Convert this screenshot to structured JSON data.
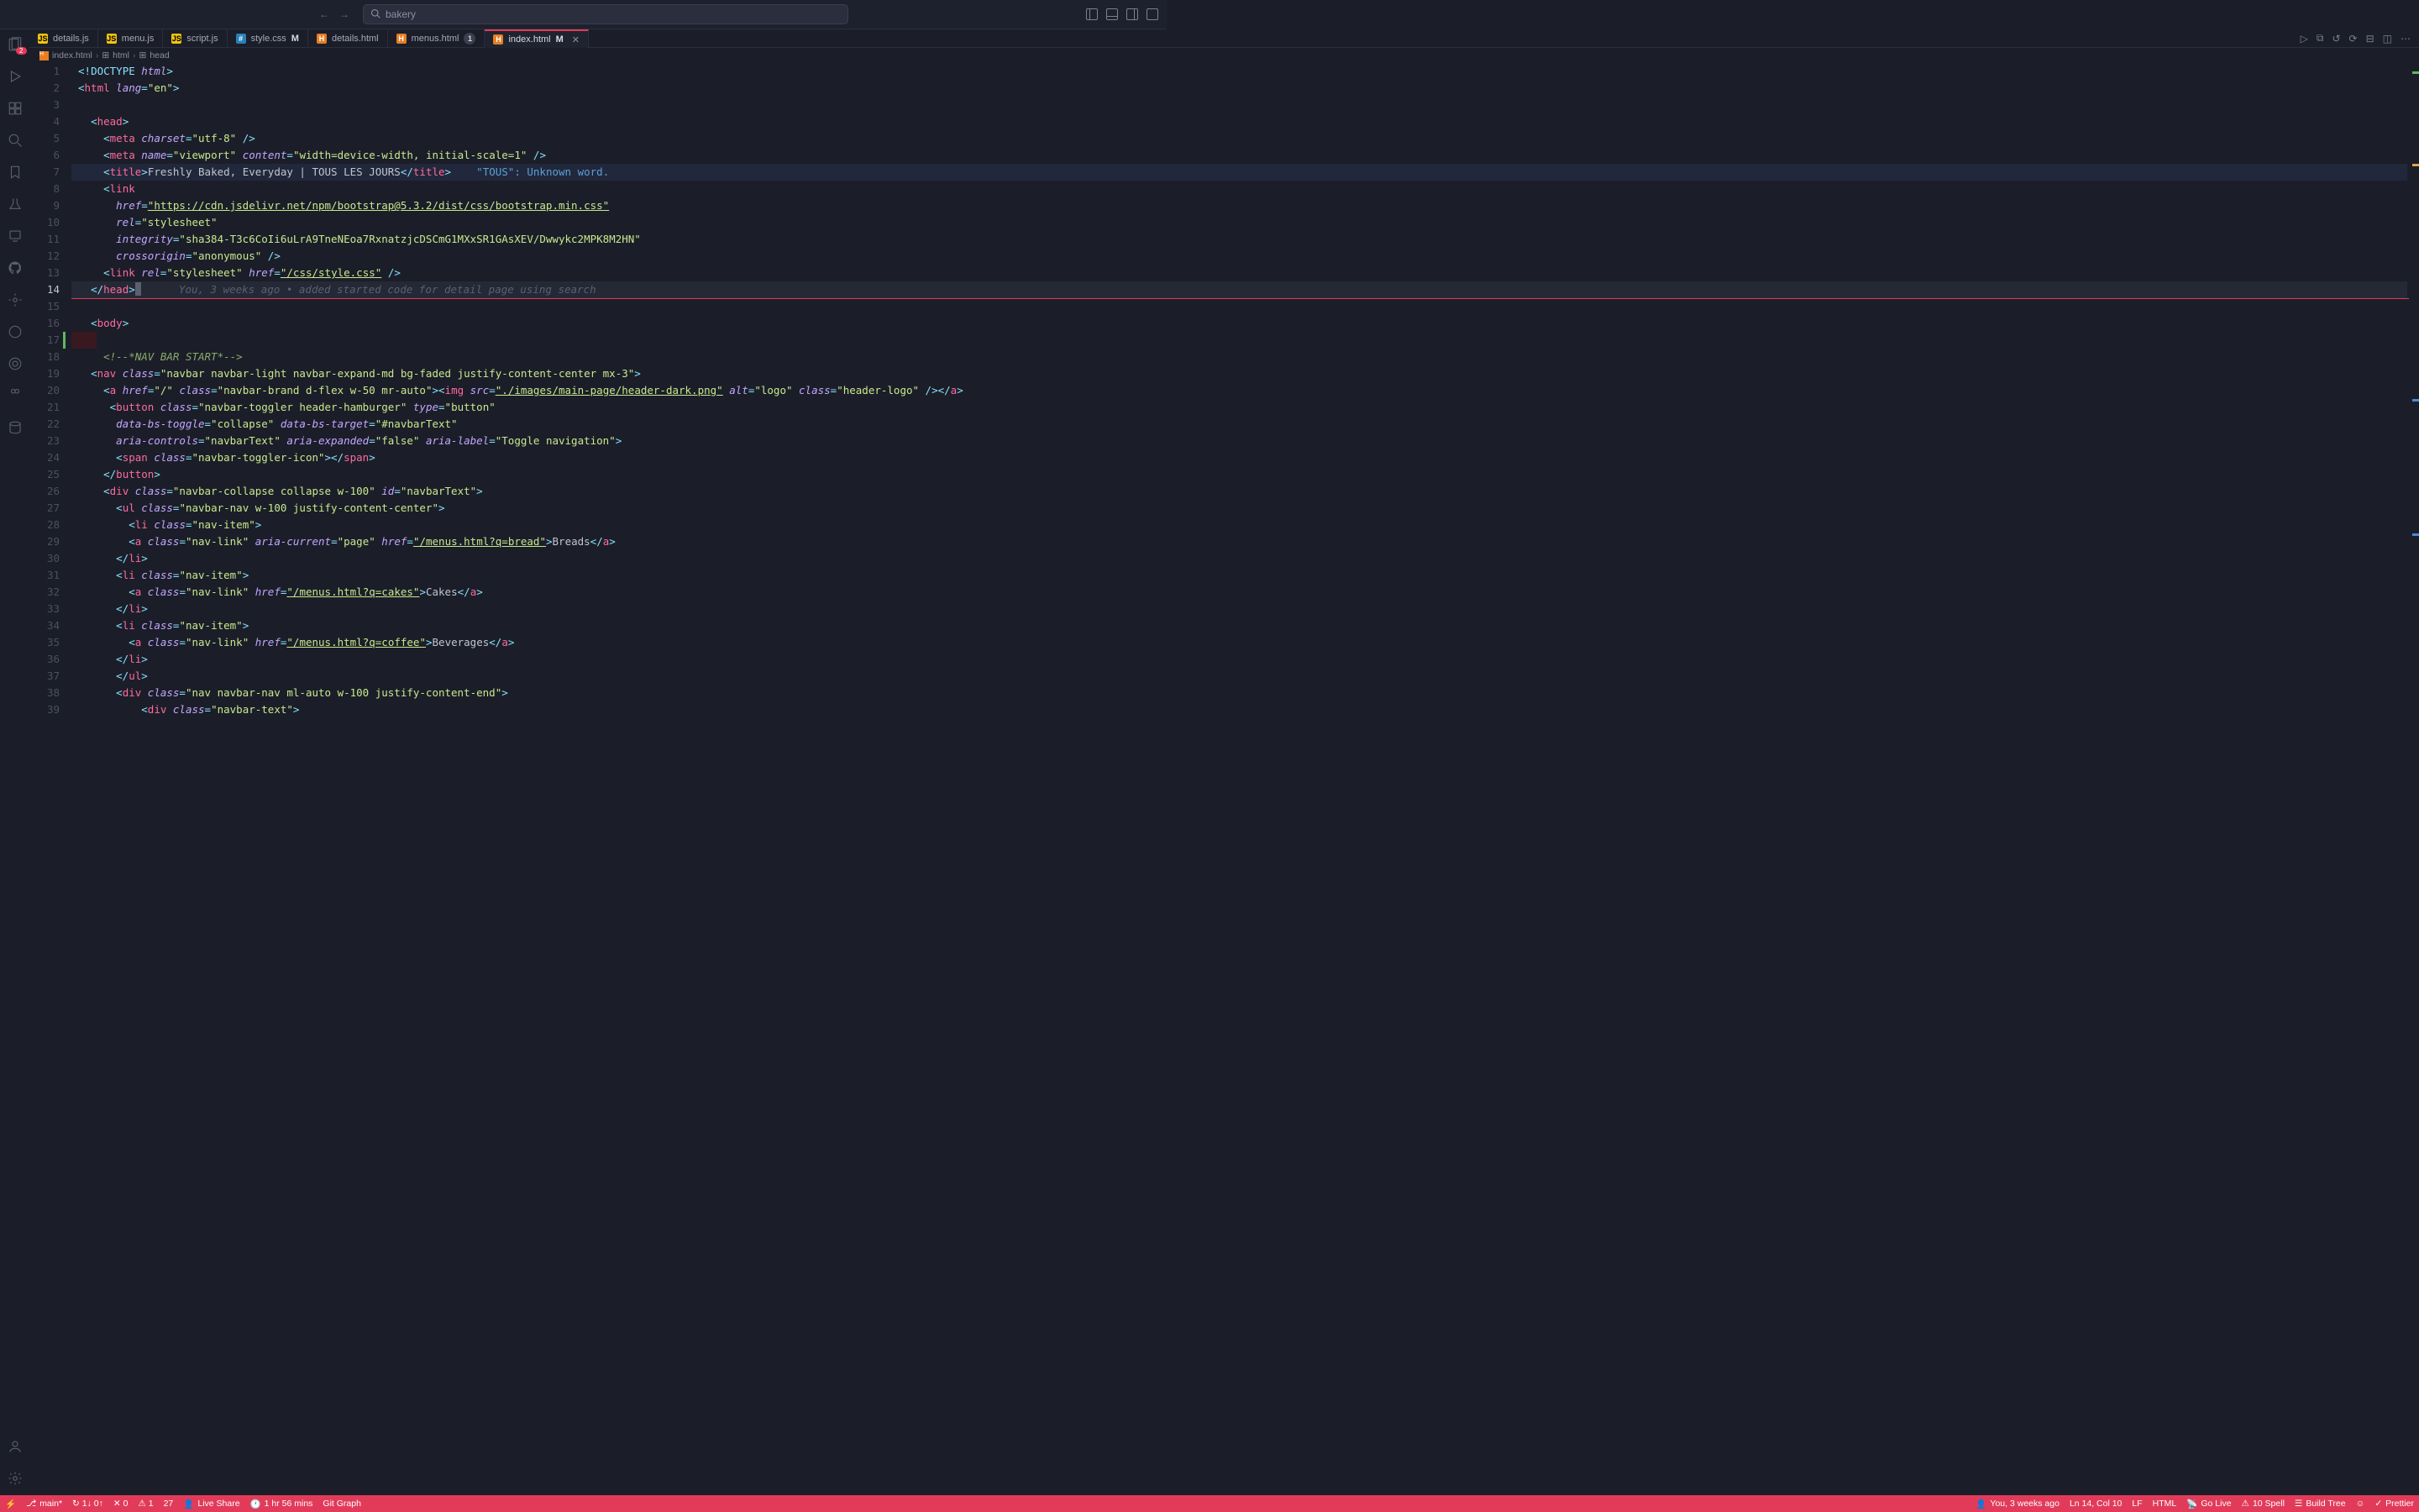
{
  "search": {
    "placeholder": "bakery"
  },
  "activity": {
    "explorer_badge": "2"
  },
  "tabs": [
    {
      "icon": "js",
      "label": "details.js",
      "status": ""
    },
    {
      "icon": "js",
      "label": "menu.js",
      "status": ""
    },
    {
      "icon": "js",
      "label": "script.js",
      "status": ""
    },
    {
      "icon": "css",
      "label": "style.css",
      "status": "M"
    },
    {
      "icon": "html",
      "label": "details.html",
      "status": ""
    },
    {
      "icon": "html",
      "label": "menus.html",
      "status": "1"
    },
    {
      "icon": "html",
      "label": "index.html",
      "status": "M",
      "active": true
    }
  ],
  "breadcrumb": [
    {
      "icon": "html",
      "label": "index.html"
    },
    {
      "icon": "tag",
      "label": "html"
    },
    {
      "icon": "tag",
      "label": "head"
    }
  ],
  "code": {
    "l1": {
      "a": "<!",
      "b": "DOCTYPE",
      "c": " html",
      "d": ">"
    },
    "l2": {
      "a": "<",
      "tag": "html",
      "attr": " lang",
      "eq": "=",
      "val": "\"en\"",
      "z": ">"
    },
    "l4": {
      "a": "<",
      "tag": "head",
      "z": ">"
    },
    "l5": {
      "a": "<",
      "tag": "meta",
      "attr": " charset",
      "val": "\"utf-8\"",
      "z": " />"
    },
    "l6": {
      "a": "<",
      "tag": "meta",
      "attr1": " name",
      "val1": "\"viewport\"",
      "attr2": " content",
      "val2": "\"width=device-width, initial-scale=1\"",
      "z": " />"
    },
    "l7": {
      "a": "<",
      "tag": "title",
      "b": ">",
      "txt": "Freshly Baked, Everyday | TOUS LES JOURS",
      "c": "</",
      "d": ">",
      "lint": "    \"TOUS\": Unknown word."
    },
    "l8": {
      "a": "<",
      "tag": "link"
    },
    "l9": {
      "attr": "href",
      "val": "\"https://cdn.jsdelivr.net/npm/bootstrap@5.3.2/dist/css/bootstrap.min.css\""
    },
    "l10": {
      "attr": "rel",
      "val": "\"stylesheet\""
    },
    "l11": {
      "attr": "integrity",
      "val": "\"sha384-T3c6CoIi6uLrA9TneNEoa7RxnatzjcDSCmG1MXxSR1GAsXEV/Dwwykc2MPK8M2HN\""
    },
    "l12": {
      "attr": "crossorigin",
      "val": "\"anonymous\"",
      "z": " />"
    },
    "l13": {
      "a": "<",
      "tag": "link",
      "attr1": " rel",
      "val1": "\"stylesheet\"",
      "attr2": " href",
      "val2": "\"/css/style.css\"",
      "z": " />"
    },
    "l14": {
      "a": "</",
      "tag": "head",
      "z": ">",
      "inlay": "      You, 3 weeks ago • added started code for detail page using search"
    },
    "l16": {
      "a": "<",
      "tag": "body",
      "z": ">"
    },
    "l18_cmt": "<!--*NAV BAR START*-->",
    "l19": {
      "a": "<",
      "tag": "nav",
      "attr": " class",
      "val": "\"navbar navbar-light navbar-expand-md bg-faded justify-content-center mx-3\"",
      "z": ">"
    },
    "l20": {
      "a": "<",
      "tag": "a",
      "attr1": " href",
      "val1": "\"/\"",
      "attr2": " class",
      "val2": "\"navbar-brand d-flex w-50 mr-auto\"",
      "b": "><",
      "tag2": "img",
      "attr3": " src",
      "val3": "\"./images/main-page/header-dark.png\"",
      "attr4": " alt",
      "val4": "\"logo\"",
      "attr5": " class",
      "val5": "\"header-logo\"",
      "z": " /></",
      "z2": ">"
    },
    "l21": {
      "a": "<",
      "tag": "button",
      "attr1": " class",
      "val1": "\"navbar-toggler header-hamburger\"",
      "attr2": " type",
      "val2": "\"button\""
    },
    "l22": {
      "attr1": "data-bs-toggle",
      "val1": "\"collapse\"",
      "attr2": " data-bs-target",
      "val2": "\"#navbarText\""
    },
    "l23": {
      "attr1": "aria-controls",
      "val1": "\"navbarText\"",
      "attr2": " aria-expanded",
      "val2": "\"false\"",
      "attr3": " aria-label",
      "val3": "\"Toggle navigation\"",
      "z": ">"
    },
    "l24": {
      "a": "<",
      "tag": "span",
      "attr": " class",
      "val": "\"navbar-toggler-icon\"",
      "b": "></",
      "z": ">"
    },
    "l25": {
      "a": "</",
      "tag": "button",
      "z": ">"
    },
    "l26": {
      "a": "<",
      "tag": "div",
      "attr1": " class",
      "val1": "\"navbar-collapse collapse w-100\"",
      "attr2": " id",
      "val2": "\"navbarText\"",
      "z": ">"
    },
    "l27": {
      "a": "<",
      "tag": "ul",
      "attr": " class",
      "val": "\"navbar-nav w-100 justify-content-center\"",
      "z": ">"
    },
    "l28": {
      "a": "<",
      "tag": "li",
      "attr": " class",
      "val": "\"nav-item\"",
      "z": ">"
    },
    "l29": {
      "a": "<",
      "tag": "a",
      "attr1": " class",
      "val1": "\"nav-link\"",
      "attr2": " aria-current",
      "val2": "\"page\"",
      "attr3": " href",
      "val3": "\"/menus.html?q=bread\"",
      "txt": "Breads",
      "z2": ">"
    },
    "l30": {
      "a": "</",
      "tag": "li",
      "z": ">"
    },
    "l31": {
      "a": "<",
      "tag": "li",
      "attr": " class",
      "val": "\"nav-item\"",
      "z": ">"
    },
    "l32": {
      "a": "<",
      "tag": "a",
      "attr1": " class",
      "val1": "\"nav-link\"",
      "attr2": " href",
      "val2": "\"/menus.html?q=cakes\"",
      "txt": "Cakes",
      "z2": ">"
    },
    "l33": {
      "a": "</",
      "tag": "li",
      "z": ">"
    },
    "l34": {
      "a": "<",
      "tag": "li",
      "attr": " class",
      "val": "\"nav-item\"",
      "z": ">"
    },
    "l35": {
      "a": "<",
      "tag": "a",
      "attr1": " class",
      "val1": "\"nav-link\"",
      "attr2": " href",
      "val2": "\"/menus.html?q=coffee\"",
      "txt": "Beverages",
      "z2": ">"
    },
    "l36": {
      "a": "</",
      "tag": "li",
      "z": ">"
    },
    "l37": {
      "a": "</",
      "tag": "ul",
      "z": ">"
    },
    "l38": {
      "a": "<",
      "tag": "div",
      "attr": " class",
      "val": "\"nav navbar-nav ml-auto w-100 justify-content-end\"",
      "z": ">"
    },
    "l39": {
      "a": "<",
      "tag": "div",
      "attr": " class",
      "val": "\"navbar-text\"",
      "z": ">"
    }
  },
  "status": {
    "branch": "main*",
    "sync": "↻ 1↓ 0↑",
    "lint1": "✕ 0",
    "lint2": "⚠ 1",
    "lint3": "27",
    "liveshare": "Live Share",
    "time": "1 hr 56 mins",
    "gitgraph": "Git Graph",
    "blame": "You, 3 weeks ago",
    "pos": "Ln 14, Col 10",
    "eol": "LF",
    "lang": "HTML",
    "golive": "Go Live",
    "spell": "10 Spell",
    "build": "Build Tree",
    "prettier": "Prettier"
  }
}
